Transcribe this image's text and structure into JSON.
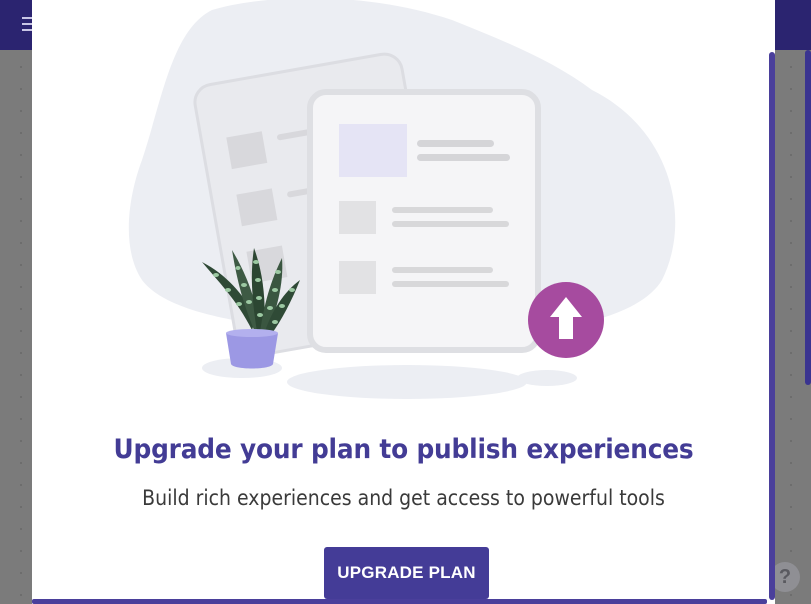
{
  "modal": {
    "title": "Upgrade your plan to publish experiences",
    "subtitle": "Build rich experiences and get access to powerful tools",
    "button_label": "UPGRADE PLAN"
  },
  "background": {
    "help_icon_glyph": "?"
  },
  "icons": {
    "menu": "hamburger-menu-icon",
    "help": "help-icon",
    "upload": "upload-arrow-icon"
  },
  "colors": {
    "header_bg": "#2b2470",
    "accent": "#433c95",
    "button_bg": "#443c97",
    "upload_circle": "#a64b9f",
    "pot": "#9c98e4",
    "overlay": "#7b7b7b"
  }
}
